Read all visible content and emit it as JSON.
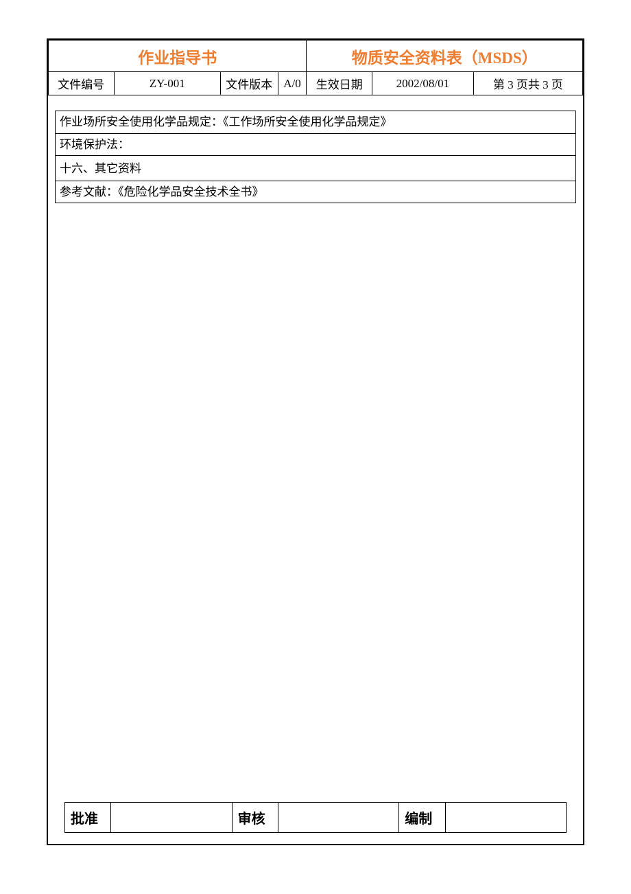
{
  "header": {
    "title_left": "作业指导书",
    "title_right": "物质安全资料表（MSDS）",
    "doc_no_label": "文件编号",
    "doc_no_value": "ZY-001",
    "version_label": "文件版本",
    "version_value": "A/0",
    "effective_label": "生效日期",
    "effective_value": "2002/08/01",
    "page_info": "第 3 页共 3 页"
  },
  "content": {
    "row1": "作业场所安全使用化学品规定：《工作场所安全使用化学品规定》",
    "row2": "环境保护法：",
    "section_header": "十六、其它资料",
    "row3": "参考文献：《危险化学品安全技术全书》"
  },
  "footer": {
    "approve_label": "批准",
    "review_label": "审核",
    "author_label": "编制"
  }
}
